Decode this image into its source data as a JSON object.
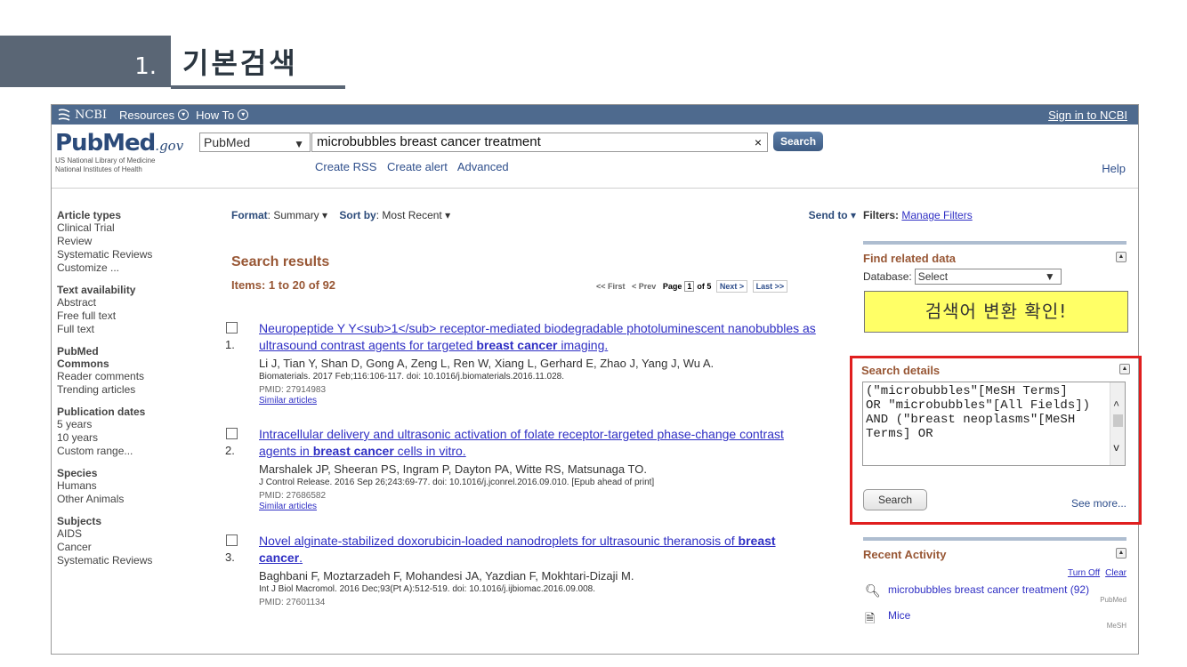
{
  "slide": {
    "number": "1.",
    "title": "기본검색"
  },
  "ncbi_bar": {
    "logo": "NCBI",
    "resources": "Resources",
    "howto": "How To",
    "sign_in": "Sign in to NCBI"
  },
  "header": {
    "logo_word": "PubMed",
    "logo_gov": ".gov",
    "logo_sub1": "US National Library of Medicine",
    "logo_sub2": "National Institutes of Health",
    "db_value": "PubMed",
    "search_value": "microbubbles breast cancer treatment",
    "search_button": "Search",
    "links": [
      "Create RSS",
      "Create alert",
      "Advanced"
    ],
    "help": "Help"
  },
  "sidebar": [
    {
      "title": "Article types",
      "items": [
        "Clinical Trial",
        "Review",
        "Systematic Reviews",
        "Customize ..."
      ]
    },
    {
      "title": "Text availability",
      "items": [
        "Abstract",
        "Free full text",
        "Full text"
      ]
    },
    {
      "title": "PubMed",
      "items": [
        "Commons",
        "Reader comments",
        "Trending articles"
      ]
    },
    {
      "title": "Publication dates",
      "items": [
        "5 years",
        "10 years",
        "Custom range..."
      ]
    },
    {
      "title": "Species",
      "items": [
        "Humans",
        "Other Animals"
      ]
    },
    {
      "title": "Subjects",
      "items": [
        "AIDS",
        "Cancer",
        "Systematic Reviews"
      ]
    }
  ],
  "format_bar": {
    "format_label": "Format",
    "format_value": "Summary",
    "sort_label": "Sort by",
    "sort_value": "Most Recent",
    "send_to": "Send to"
  },
  "results": {
    "title": "Search results",
    "count": "Items: 1 to 20 of 92",
    "pager": {
      "first": "<< First",
      "prev": "< Prev",
      "page_label": "Page",
      "page": "1",
      "of": "of 5",
      "next": "Next >",
      "last": "Last >>"
    },
    "items": [
      {
        "num": "1.",
        "title1_pre": "Neuropeptide Y Y<sub>1</sub> receptor-mediated biodegradable photoluminescent nanobubbles as",
        "title2_pre": "ultrasound contrast agents for targeted ",
        "title2_hl": "breast cancer",
        "title2_post": " imaging.",
        "authors": "Li J, Tian Y, Shan D, Gong A, Zeng L, Ren W, Xiang L, Gerhard E, Zhao J, Yang J, Wu A.",
        "journal": "Biomaterials. 2017 Feb;116:106-117. doi: 10.1016/j.biomaterials.2016.11.028.",
        "pmid": "PMID: 27914983",
        "similar": "Similar articles"
      },
      {
        "num": "2.",
        "title1_pre": "Intracellular delivery and ultrasonic activation of folate receptor-targeted phase-change contrast",
        "title2_pre": "agents in ",
        "title2_hl": "breast cancer",
        "title2_post": " cells in vitro.",
        "authors": "Marshalek JP, Sheeran PS, Ingram P, Dayton PA, Witte RS, Matsunaga TO.",
        "journal": "J Control Release. 2016 Sep 26;243:69-77. doi: 10.1016/j.jconrel.2016.09.010. [Epub ahead of print]",
        "pmid": "PMID: 27686582",
        "similar": "Similar articles"
      },
      {
        "num": "3.",
        "title1_pre": "Novel alginate-stabilized doxorubicin-loaded nanodroplets for ultrasounic theranosis of ",
        "title1_hl": "breast",
        "title2_pre": "",
        "title2_hl": "cancer",
        "title2_post": ".",
        "authors": "Baghbani F, Moztarzadeh F, Mohandesi JA, Yazdian F, Mokhtari-Dizaji M.",
        "journal": "Int J Biol Macromol. 2016 Dec;93(Pt A):512-519. doi: 10.1016/j.ijbiomac.2016.09.008.",
        "pmid": "PMID: 27601134",
        "similar": ""
      }
    ]
  },
  "right": {
    "filters_label": "Filters:",
    "manage_filters": "Manage Filters",
    "find_related": "Find related data",
    "database_label": "Database:",
    "database_value": "Select",
    "callout": "검색어 변환 확인!",
    "search_details_title": "Search details",
    "search_details_text": "(\"microbubbles\"[MeSH Terms]\nOR \"microbubbles\"[All Fields]) AND (\"breast neoplasms\"[MeSH Terms] OR",
    "search_button": "Search",
    "see_more": "See more...",
    "recent_title": "Recent Activity",
    "turn_off": "Turn Off",
    "clear": "Clear",
    "recent_items": [
      {
        "text": "microbubbles breast cancer treatment (92)",
        "source": "PubMed",
        "icon": "search-icon"
      },
      {
        "text": "Mice",
        "source": "MeSH",
        "icon": "document-icon"
      }
    ]
  }
}
